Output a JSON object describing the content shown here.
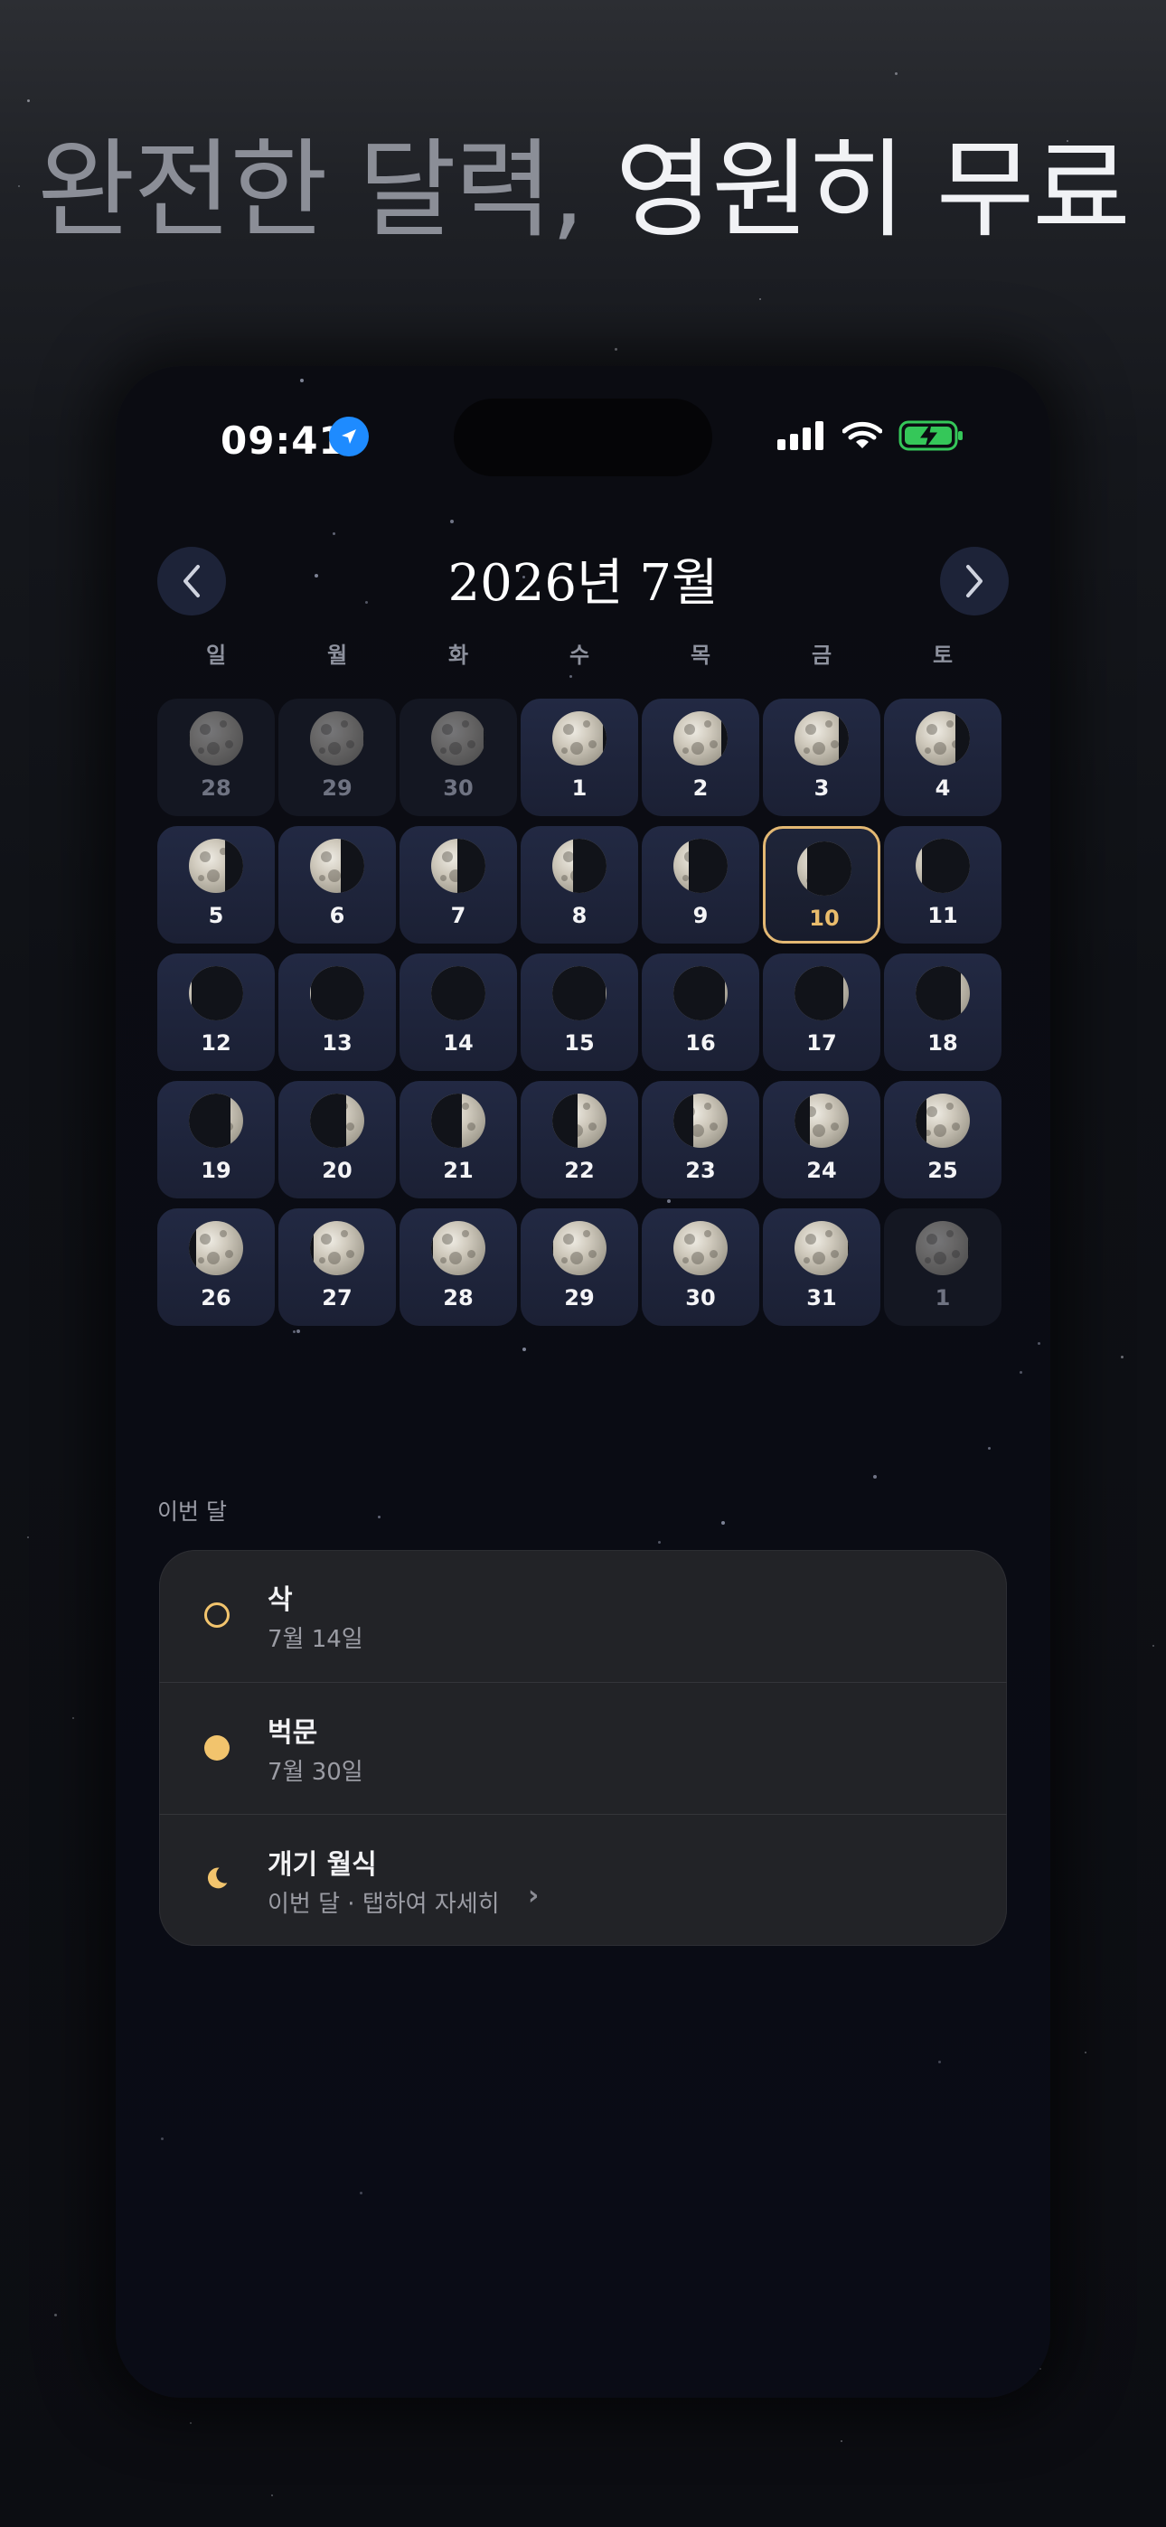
{
  "headline": {
    "part1": "완전한 달력,",
    "part2": "영원히 무료"
  },
  "status_bar": {
    "time": "09:41",
    "battery_color": "#35c759"
  },
  "calendar": {
    "title": "2026년 7월",
    "weekdays": [
      "일",
      "월",
      "화",
      "수",
      "목",
      "금",
      "토"
    ],
    "days": [
      {
        "day": "28",
        "illum": 0.99,
        "waxing": true,
        "other": true
      },
      {
        "day": "29",
        "illum": 0.99,
        "waxing": false,
        "other": true
      },
      {
        "day": "30",
        "illum": 0.97,
        "waxing": false,
        "other": true
      },
      {
        "day": "1",
        "illum": 0.93,
        "waxing": false
      },
      {
        "day": "2",
        "illum": 0.88,
        "waxing": false
      },
      {
        "day": "3",
        "illum": 0.82,
        "waxing": false
      },
      {
        "day": "4",
        "illum": 0.74,
        "waxing": false
      },
      {
        "day": "5",
        "illum": 0.66,
        "waxing": false
      },
      {
        "day": "6",
        "illum": 0.57,
        "waxing": false
      },
      {
        "day": "7",
        "illum": 0.48,
        "waxing": false
      },
      {
        "day": "8",
        "illum": 0.38,
        "waxing": false
      },
      {
        "day": "9",
        "illum": 0.28,
        "waxing": false
      },
      {
        "day": "10",
        "illum": 0.19,
        "waxing": false,
        "today": true
      },
      {
        "day": "11",
        "illum": 0.11,
        "waxing": false
      },
      {
        "day": "12",
        "illum": 0.05,
        "waxing": false
      },
      {
        "day": "13",
        "illum": 0.01,
        "waxing": false
      },
      {
        "day": "14",
        "illum": 0.0,
        "waxing": true
      },
      {
        "day": "15",
        "illum": 0.02,
        "waxing": true
      },
      {
        "day": "16",
        "illum": 0.05,
        "waxing": true
      },
      {
        "day": "17",
        "illum": 0.1,
        "waxing": true
      },
      {
        "day": "18",
        "illum": 0.16,
        "waxing": true
      },
      {
        "day": "19",
        "illum": 0.24,
        "waxing": true
      },
      {
        "day": "20",
        "illum": 0.33,
        "waxing": true
      },
      {
        "day": "21",
        "illum": 0.43,
        "waxing": true
      },
      {
        "day": "22",
        "illum": 0.53,
        "waxing": true
      },
      {
        "day": "23",
        "illum": 0.63,
        "waxing": true
      },
      {
        "day": "24",
        "illum": 0.72,
        "waxing": true
      },
      {
        "day": "25",
        "illum": 0.8,
        "waxing": true
      },
      {
        "day": "26",
        "illum": 0.87,
        "waxing": true
      },
      {
        "day": "27",
        "illum": 0.93,
        "waxing": true
      },
      {
        "day": "28",
        "illum": 0.97,
        "waxing": true
      },
      {
        "day": "29",
        "illum": 0.99,
        "waxing": true
      },
      {
        "day": "30",
        "illum": 1.0,
        "waxing": true
      },
      {
        "day": "31",
        "illum": 0.99,
        "waxing": false
      },
      {
        "day": "1",
        "illum": 0.97,
        "waxing": false,
        "other": true
      }
    ]
  },
  "this_month": {
    "label": "이번 달",
    "items": [
      {
        "title": "삭",
        "subtitle": "7월 14일",
        "icon": "new-moon-icon",
        "color": "#f2c46d"
      },
      {
        "title": "벅문",
        "subtitle": "7월 30일",
        "icon": "full-moon-icon",
        "color": "#f2c46d"
      },
      {
        "title": "개기 월식",
        "subtitle": "이번 달 · 탭하여 자세히",
        "icon": "crescent-moon-icon",
        "color": "#f2c46d"
      }
    ]
  }
}
